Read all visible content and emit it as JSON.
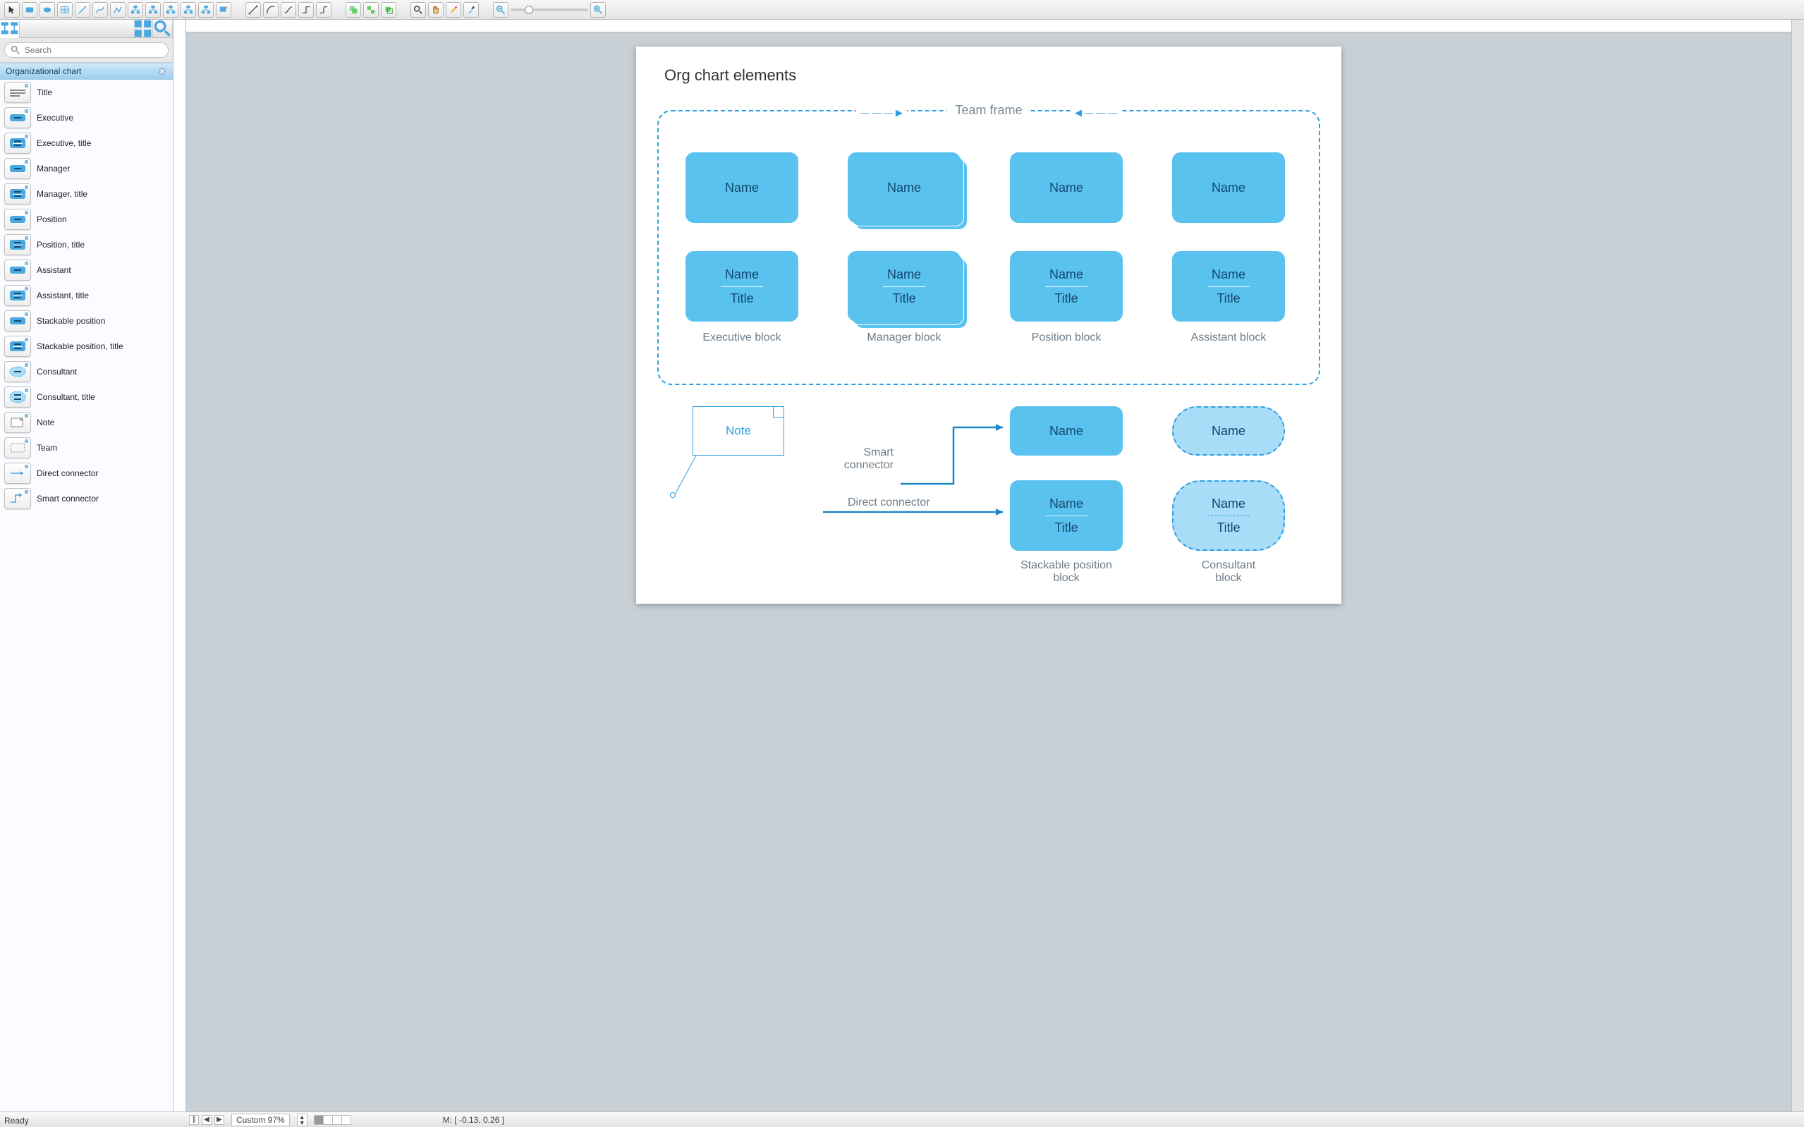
{
  "toolbar_icons": [
    "pointer",
    "rectangle",
    "ellipse",
    "table",
    "line",
    "curve",
    "polyline",
    "tree-down",
    "tree-up",
    "tree-left",
    "tree-right",
    "org-auto",
    "new-shape",
    "gap",
    "connect-line",
    "connect-arc",
    "connect-spline",
    "connect-orth",
    "connect-round",
    "gap",
    "group",
    "ungroup",
    "bring-front",
    "gap",
    "zoom-fit",
    "pan-hand",
    "highlight",
    "eyedropper",
    "gap",
    "zoom-out",
    "zoom-slider",
    "zoom-in"
  ],
  "left_tabs": [
    "tree-icon",
    "grid-icon",
    "search-icon"
  ],
  "search_placeholder": "Search",
  "category": "Organizational chart",
  "stencils": [
    {
      "key": "title",
      "label": "Title",
      "shape": "title"
    },
    {
      "key": "executive",
      "label": "Executive",
      "shape": "solid"
    },
    {
      "key": "executive-title",
      "label": "Executive, title",
      "shape": "solid-title"
    },
    {
      "key": "manager",
      "label": "Manager",
      "shape": "solid"
    },
    {
      "key": "manager-title",
      "label": "Manager, title",
      "shape": "solid-title"
    },
    {
      "key": "position",
      "label": "Position",
      "shape": "solid"
    },
    {
      "key": "position-title",
      "label": "Position, title",
      "shape": "solid-title"
    },
    {
      "key": "assistant",
      "label": "Assistant",
      "shape": "solid"
    },
    {
      "key": "assistant-title",
      "label": "Assistant, title",
      "shape": "solid-title"
    },
    {
      "key": "stackable-position",
      "label": "Stackable position",
      "shape": "solid"
    },
    {
      "key": "stackable-position-title",
      "label": "Stackable position, title",
      "shape": "solid-title"
    },
    {
      "key": "consultant",
      "label": "Consultant",
      "shape": "dashed"
    },
    {
      "key": "consultant-title",
      "label": "Consultant, title",
      "shape": "dashed-title"
    },
    {
      "key": "note",
      "label": "Note",
      "shape": "note"
    },
    {
      "key": "team",
      "label": "Team",
      "shape": "team"
    },
    {
      "key": "direct-connector",
      "label": "Direct connector",
      "shape": "direct"
    },
    {
      "key": "smart-connector",
      "label": "Smart connector",
      "shape": "smart"
    }
  ],
  "diagram": {
    "title": "Org chart elements",
    "team_label": "Team frame",
    "row1": [
      {
        "label": "Name",
        "cap": "Executive block",
        "stack": false
      },
      {
        "label": "Name",
        "cap": "Manager block",
        "stack": true
      },
      {
        "label": "Name",
        "cap": "Position block",
        "stack": false
      },
      {
        "label": "Name",
        "cap": "Assistant block",
        "stack": false
      }
    ],
    "row2_name": "Name",
    "row2_title": "Title",
    "note": "Note",
    "smart_connector": "Smart connector",
    "direct_connector": "Direct connector",
    "stackable_name": "Name",
    "stackable_title": "Title",
    "stackable_cap": "Stackable position block",
    "consultant_name": "Name",
    "consultant_title": "Title",
    "consultant_cap": "Consultant block"
  },
  "bottom": {
    "zoom": "Custom 97%",
    "mouse": "M: [ -0.13, 0.26 ]",
    "ready": "Ready"
  }
}
